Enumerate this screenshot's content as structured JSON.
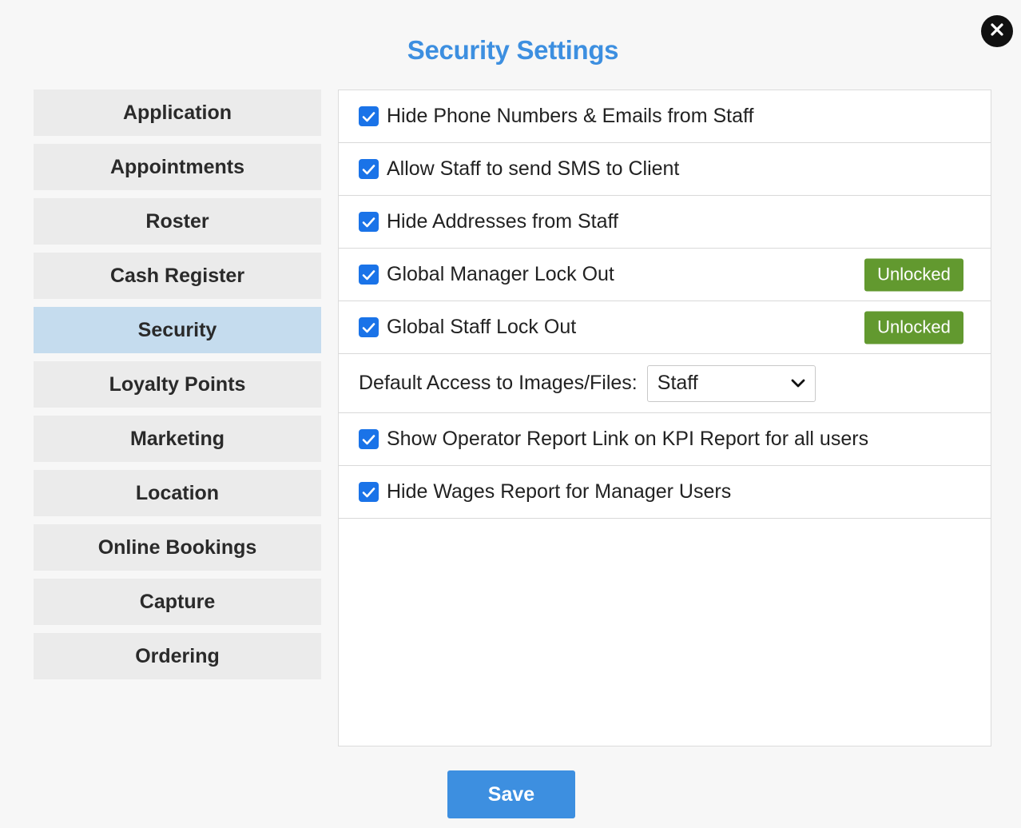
{
  "dialog": {
    "title": "Security Settings",
    "close_icon": "close-icon"
  },
  "sidebar": {
    "items": [
      {
        "label": "Application",
        "active": false
      },
      {
        "label": "Appointments",
        "active": false
      },
      {
        "label": "Roster",
        "active": false
      },
      {
        "label": "Cash Register",
        "active": false
      },
      {
        "label": "Security",
        "active": true
      },
      {
        "label": "Loyalty Points",
        "active": false
      },
      {
        "label": "Marketing",
        "active": false
      },
      {
        "label": "Location",
        "active": false
      },
      {
        "label": "Online Bookings",
        "active": false
      },
      {
        "label": "Capture",
        "active": false
      },
      {
        "label": "Ordering",
        "active": false
      }
    ]
  },
  "settings": {
    "hide_phone": {
      "label": "Hide Phone Numbers & Emails from Staff",
      "checked": true
    },
    "allow_sms": {
      "label": "Allow Staff to send SMS to Client",
      "checked": true
    },
    "hide_addresses": {
      "label": "Hide Addresses from Staff",
      "checked": true
    },
    "manager_lockout": {
      "label": "Global Manager Lock Out",
      "checked": true,
      "status": "Unlocked"
    },
    "staff_lockout": {
      "label": "Global Staff Lock Out",
      "checked": true,
      "status": "Unlocked"
    },
    "default_access": {
      "label": "Default Access to Images/Files:",
      "selected": "Staff"
    },
    "operator_report": {
      "label": "Show Operator Report Link on KPI Report for all users",
      "checked": true
    },
    "hide_wages": {
      "label": "Hide Wages Report for Manager Users",
      "checked": true
    }
  },
  "footer": {
    "save_label": "Save"
  },
  "colors": {
    "accent": "#3d8fe0",
    "checkbox": "#1a73e8",
    "unlocked_badge": "#62992f",
    "active_sidebar": "#c5dcee"
  }
}
